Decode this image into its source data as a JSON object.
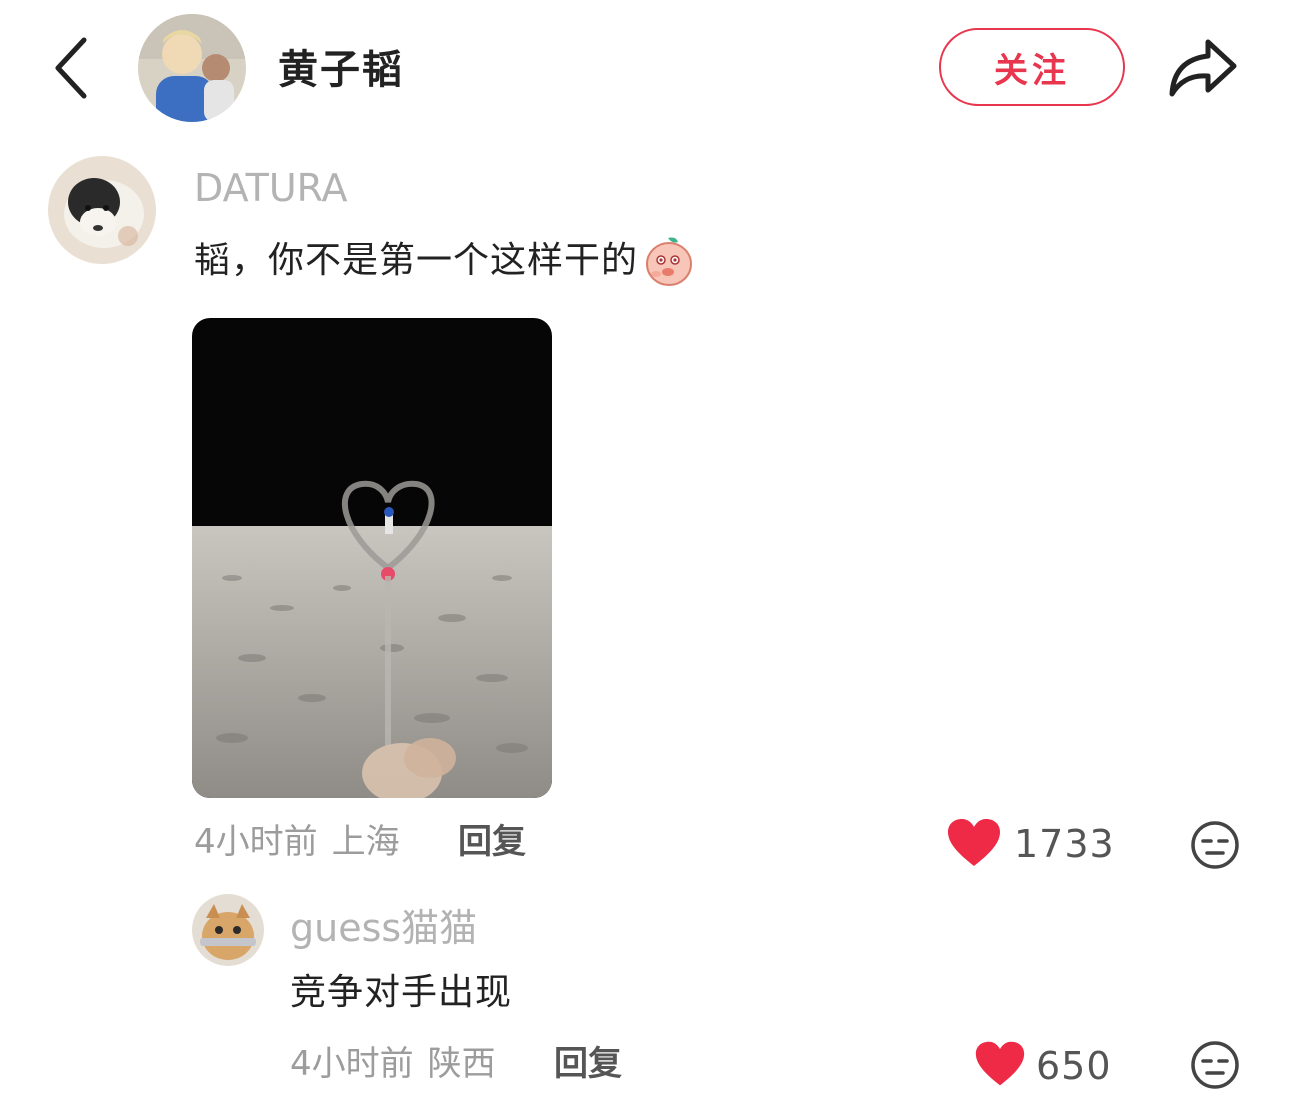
{
  "header": {
    "title": "黄子韬",
    "follow_label": "关注"
  },
  "comments": [
    {
      "username": "DATURA",
      "text": "韬，你不是第一个这样干的",
      "emoji": "peach-face-emoji",
      "time": "4小时前",
      "location": "上海",
      "reply_label": "回复",
      "likes": "1733",
      "has_image": true
    }
  ],
  "replies": [
    {
      "username": "guess猫猫",
      "text": "竞争对手出现",
      "time": "4小时前",
      "location": "陕西",
      "reply_label": "回复",
      "likes": "650"
    }
  ],
  "icons": {
    "back": "chevron-left-icon",
    "share": "share-arrow-icon",
    "like": "heart-icon",
    "react": "neutral-face-icon"
  },
  "colors": {
    "accent": "#e8364e",
    "username": "#b3b3b3",
    "meta": "#9c9c9c"
  }
}
